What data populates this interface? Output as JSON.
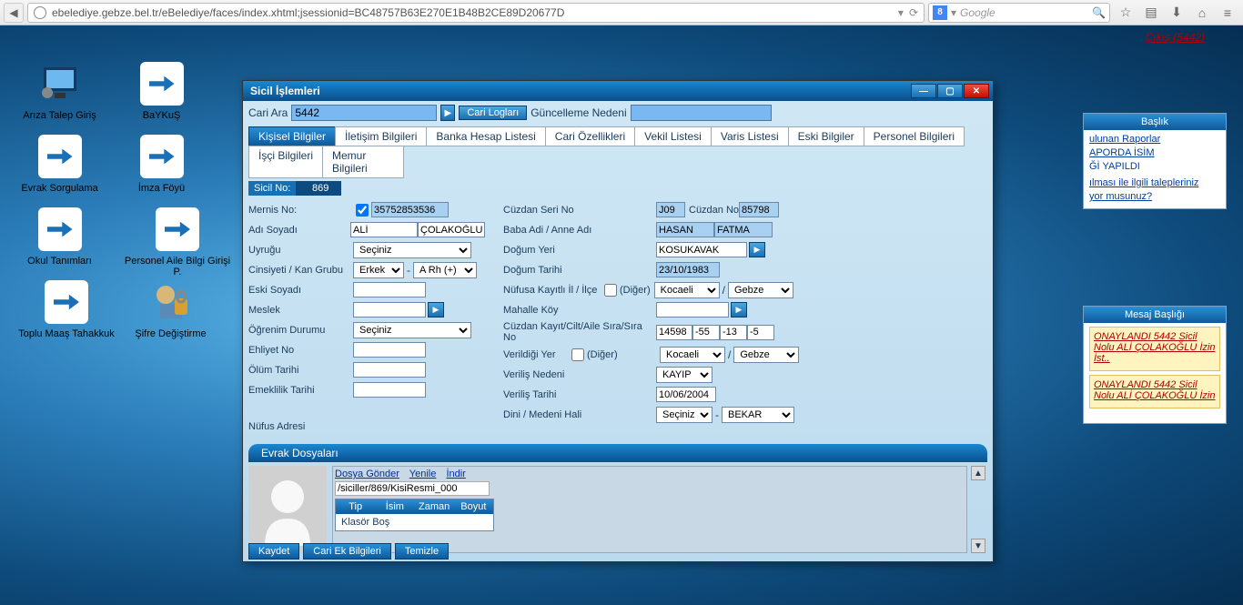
{
  "browser": {
    "url": "ebelediye.gebze.bel.tr/eBelediye/faces/index.xhtml;jsessionid=BC48757B63E270E1B48B2CE89D20677D",
    "search_provider": "Google"
  },
  "logout": "Çıkış (5442)",
  "desktop_icons": {
    "ariza": "Arıza Talep Giriş",
    "baykus": "BaYKuŞ",
    "evrak_sorg": "Evrak Sorgulama",
    "imza": "İmza Föyü",
    "okul": "Okul Tanımları",
    "personel_aile": "Personel Aile Bilgi Girişi P.",
    "toplu_maas": "Toplu Maaş Tahakkuk",
    "sifre": "Şifre Değiştirme"
  },
  "dialog": {
    "title": "Sicil İşlemleri",
    "cari_label": "Cari Ara",
    "cari_value": "5442",
    "cari_loglari": "Cari Logları",
    "guncelleme_label": "Güncelleme Nedeni",
    "tabs": {
      "kisisel": "Kişisel Bilgiler",
      "iletisim": "İletişim Bilgileri",
      "banka": "Banka Hesap Listesi",
      "cari_oz": "Cari Özellikleri",
      "vekil": "Vekil Listesi",
      "varis": "Varis Listesi",
      "eski": "Eski Bilgiler",
      "personel": "Personel Bilgileri",
      "isci": "İşçi Bilgileri",
      "memur": "Memur Bilgileri"
    },
    "sicil_label": "Sicil No:",
    "sicil_value": "869",
    "left": {
      "mernis_label": "Mernis No:",
      "mernis_value": "35752853536",
      "ad_label": "Adı Soyadı",
      "ad_value": "ALİ",
      "soyad_value": "ÇOLAKOĞLU",
      "uyruk_label": "Uyruğu",
      "uyruk_value": "Seçiniz",
      "cinsiyet_label": "Cinsiyeti / Kan Grubu",
      "cinsiyet_value": "Erkek",
      "kan_value": "A Rh (+)",
      "eski_soyad_label": "Eski Soyadı",
      "meslek_label": "Meslek",
      "ogrenim_label": "Öğrenim Durumu",
      "ogrenim_value": "Seçiniz",
      "ehliyet_label": "Ehliyet No",
      "olum_label": "Ölüm Tarihi",
      "emeklilik_label": "Emeklilik Tarihi",
      "nufus_adresi_label": "Nüfus Adresi"
    },
    "right": {
      "cuzdan_seri_label": "Cüzdan Seri No",
      "cuzdan_seri_value": "J09",
      "cuzdan_no_label": "Cüzdan No",
      "cuzdan_no_value": "85798",
      "baba_anne_label": "Baba Adi / Anne Adı",
      "baba_value": "HASAN",
      "anne_value": "FATMA",
      "dogum_yeri_label": "Doğum Yeri",
      "dogum_yeri_value": "KOSUKAVAK",
      "dogum_tarihi_label": "Doğum Tarihi",
      "dogum_tarihi_value": "23/10/1983",
      "nufusa_label": "Nüfusa Kayıtlı İl / İlçe",
      "diger_label": "(Diğer)",
      "il_value": "Kocaeli",
      "ilce_value": "Gebze",
      "mahalle_label": "Mahalle Köy",
      "cuzdan_kayit_label": "Cüzdan Kayıt/Cilt/Aile Sıra/Sıra No",
      "ck1": "14598",
      "ck2": "-55",
      "ck3": "-13",
      "ck4": "-5",
      "verildigi_label": "Verildiği Yer",
      "v_il": "Kocaeli",
      "v_ilce": "Gebze",
      "verilis_neden_label": "Veriliş Nedeni",
      "verilis_neden_value": "KAYIP",
      "verilis_tarih_label": "Veriliş Tarihi",
      "verilis_tarih_value": "10/06/2004",
      "dini_label": "Dini / Medeni Hali",
      "dini_value": "Seçiniz",
      "medeni_value": "BEKAR"
    },
    "evrak_section": "Evrak Dosyaları",
    "file": {
      "dosya_gonder": "Dosya Gönder",
      "yenile": "Yenile",
      "indir": "İndir",
      "path": "/siciller/869/KisiResmi_000",
      "col_tip": "Tip",
      "col_isim": "İsim",
      "col_zaman": "Zaman",
      "col_boyut": "Boyut",
      "empty": "Klasör Boş"
    },
    "buttons": {
      "kaydet": "Kaydet",
      "cari_ek": "Cari Ek Bilgileri",
      "temizle": "Temizle"
    }
  },
  "panel_baslik": {
    "header": "Başlık",
    "l1": "ulunan Raporlar",
    "l2": "APORDA İSİM",
    "l3": "Ğİ YAPILDI",
    "l4": "ılması ile ilgili talepleriniz",
    "l5": "yor musunuz?"
  },
  "panel_mesaj": {
    "header": "Mesaj Başlığı",
    "m1": "ONAYLANDI 5442 Sicil Nolu ALİ ÇOLAKOĞLU İzin İst..",
    "m2": "ONAYLANDI 5442 Sicil Nolu ALİ ÇOLAKOĞLU İzin"
  }
}
